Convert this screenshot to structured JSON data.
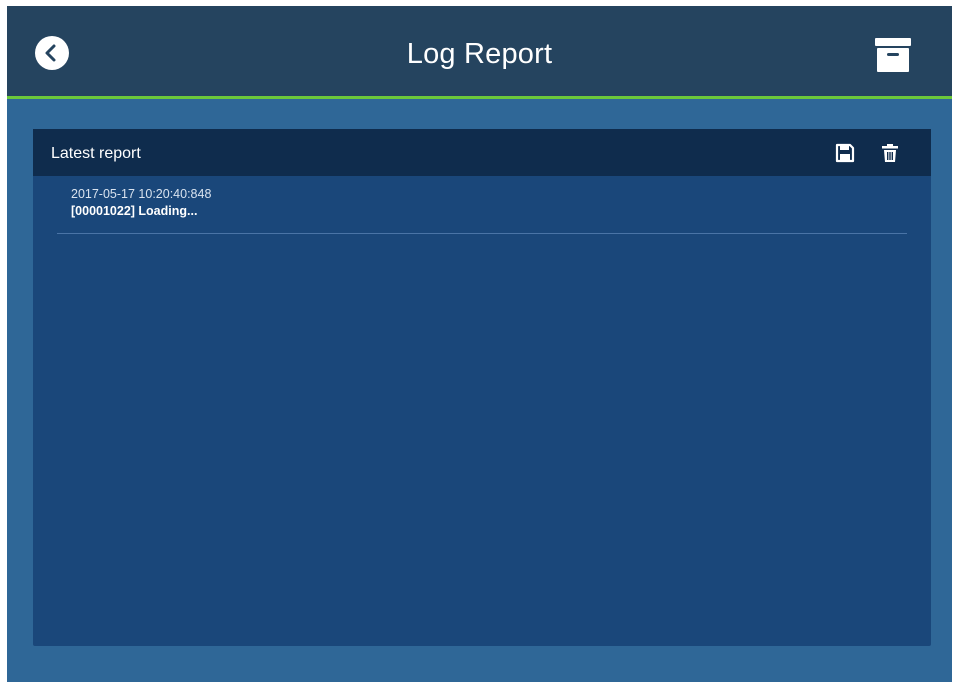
{
  "header": {
    "title": "Log Report",
    "back_icon": "chevron-left-icon",
    "archive_icon": "archive-box-icon"
  },
  "colors": {
    "header_bg": "#25445f",
    "accent_line": "#6cc83a",
    "screen_bg": "#2f6797",
    "panel_bg": "#1a477a",
    "panel_header_bg": "#0f2c4d"
  },
  "report": {
    "title": "Latest report",
    "save_icon": "save-icon",
    "delete_icon": "trash-icon",
    "entries": [
      {
        "timestamp": "2017-05-17 10:20:40:848",
        "message": "[00001022] Loading..."
      }
    ]
  }
}
